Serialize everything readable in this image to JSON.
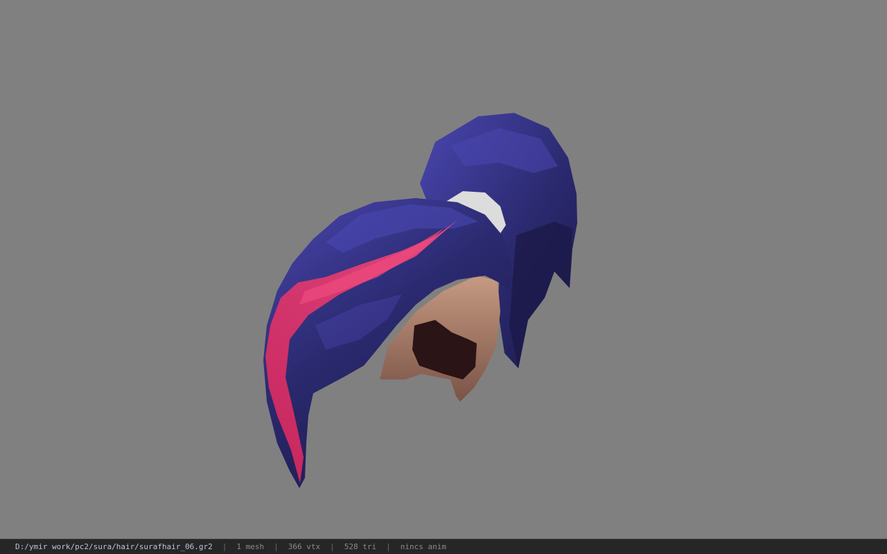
{
  "viewport": {
    "background": "#808080",
    "model_name": "sura-hair-model",
    "colors": {
      "hair_dark": "#1c1948",
      "hair_mid": "#2b2a70",
      "hair_light": "#4a47b0",
      "streak": "#d4265c",
      "streak_light": "#f04a7e",
      "skin": "#c69a82",
      "skin_shadow": "#7a5346",
      "tie": "#dcdcdc"
    }
  },
  "status": {
    "path": "D:/ymir work/pc2/sura/hair/surafhair_06.gr2",
    "separator": "|",
    "mesh": "1 mesh",
    "vertices": "366 vtx",
    "triangles": "528 tri",
    "anim": "nincs anim"
  }
}
